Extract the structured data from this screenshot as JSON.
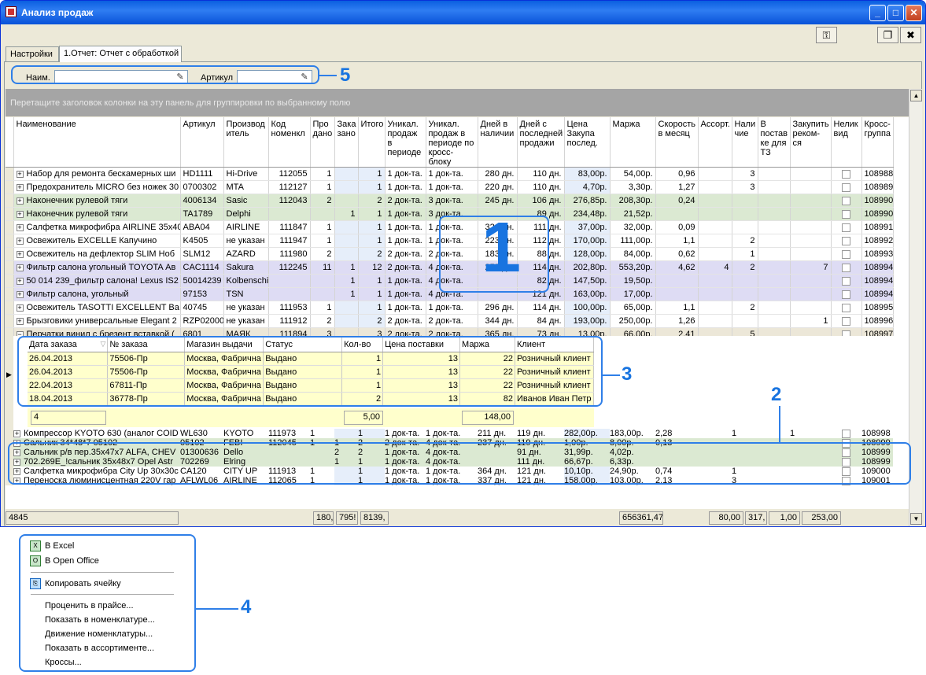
{
  "window": {
    "title": "Анализ продаж"
  },
  "tabs": [
    {
      "label": "Настройки"
    },
    {
      "label": "1.Отчет: Отчет с обработкой"
    }
  ],
  "filters": {
    "name_label": "Наим.",
    "article_label": "Артикул"
  },
  "group_panel_text": "Перетащите заголовок колонки на эту панель для группировки по выбранному полю",
  "columns": [
    "Наименование",
    "Артикул",
    "Производ итель",
    "Код номенкл",
    "Про дано",
    "Зака зано",
    "Итого",
    "Уникал. продаж в периоде",
    "Уникал. продаж в периоде по кросс-блоку",
    "Дней в наличии",
    "Дней с последней продажи",
    "Цена Закупа послед.",
    "Маржа",
    "Скорость в месяц",
    "Ассорт.",
    "Нали чие",
    "В постав ке для ТЗ",
    "Закупить реком-ся",
    "Нелик вид",
    "Кросс- группа"
  ],
  "rows": [
    {
      "style": "white",
      "exp": "+",
      "c": [
        "Набор для ремонта бескамерных ши",
        "HD1111",
        "Hi-Drive",
        "112055",
        "1",
        "",
        "1",
        "1 док-та.",
        "1 док-та.",
        "280 дн.",
        "110 дн.",
        "83,00р.",
        "54,00р.",
        "0,96",
        "",
        "3",
        "",
        "",
        "",
        "108988"
      ]
    },
    {
      "style": "white",
      "exp": "+",
      "c": [
        "Предохранитель MICRO без ножек 30",
        "0700302",
        "MTA",
        "112127",
        "1",
        "",
        "1",
        "1 док-та.",
        "1 док-та.",
        "220 дн.",
        "110 дн.",
        "4,70р.",
        "3,30р.",
        "1,27",
        "",
        "3",
        "",
        "",
        "",
        "108989"
      ]
    },
    {
      "style": "green",
      "exp": "+",
      "c": [
        "Наконечник рулевой тяги",
        "4006134",
        "Sasic",
        "112043",
        "2",
        "",
        "2",
        "2 док-та.",
        "3 док-та.",
        "245 дн.",
        "106 дн.",
        "276,85р.",
        "208,30р.",
        "0,24",
        "",
        "",
        "",
        "",
        "",
        "108990"
      ]
    },
    {
      "style": "green",
      "exp": "+",
      "c": [
        "Наконечник рулевой тяги",
        "TA1789",
        "Delphi",
        "",
        "",
        "1",
        "1",
        "1 док-та.",
        "3 док-та.",
        "",
        "89 дн.",
        "234,48р.",
        "21,52р.",
        "",
        "",
        "",
        "",
        "",
        "",
        "108990"
      ]
    },
    {
      "style": "white",
      "exp": "+",
      "c": [
        "Салфетка микрофибра AIRLINE 35x40",
        "ABA04",
        "AIRLINE",
        "111847",
        "1",
        "",
        "1",
        "1 док-та.",
        "1 док-та.",
        "321 дн.",
        "111 дн.",
        "37,00р.",
        "32,00р.",
        "0,09",
        "",
        "",
        "",
        "",
        "",
        "108991"
      ]
    },
    {
      "style": "white",
      "exp": "+",
      "c": [
        "Освежитель EXCELLE Капучино",
        "K4505",
        "не указан",
        "111947",
        "1",
        "",
        "1",
        "1 док-та.",
        "1 док-та.",
        "223 дн.",
        "112 дн.",
        "170,00р.",
        "111,00р.",
        "1,1",
        "",
        "2",
        "",
        "",
        "",
        "108992"
      ]
    },
    {
      "style": "white",
      "exp": "+",
      "c": [
        "Освежитель на дефлектор SLIM Ноб",
        "SLM12",
        "AZARD",
        "111980",
        "2",
        "",
        "2",
        "2 док-та.",
        "2 док-та.",
        "183 дн.",
        "88 дн.",
        "128,00р.",
        "84,00р.",
        "0,62",
        "",
        "1",
        "",
        "",
        "",
        "108993"
      ]
    },
    {
      "style": "purple",
      "exp": "+",
      "c": [
        "Фильтр салона угольный TOYOTA Ав",
        "CAC1114",
        "Sakura",
        "112245",
        "11",
        "1",
        "12",
        "2 док-та.",
        "4 док-та.",
        "253 дн.",
        "114 дн.",
        "202,80р.",
        "553,20р.",
        "4,62",
        "4",
        "2",
        "",
        "7",
        "",
        "108994"
      ]
    },
    {
      "style": "purple",
      "exp": "+",
      "c": [
        "50 014 239_фильтр салона! Lexus IS2",
        "50014239",
        "Kolbenschi",
        "",
        "",
        "1",
        "1",
        "1 док-та.",
        "4 док-та.",
        "",
        "82 дн.",
        "147,50р.",
        "19,50р.",
        "",
        "",
        "",
        "",
        "",
        "",
        "108994"
      ]
    },
    {
      "style": "purple",
      "exp": "+",
      "c": [
        "Фильтр салона, угольный",
        "97153",
        "TSN",
        "",
        "",
        "1",
        "1",
        "1 док-та.",
        "4 док-та.",
        "",
        "121 дн.",
        "163,00р.",
        "17,00р.",
        "",
        "",
        "",
        "",
        "",
        "",
        "108994"
      ]
    },
    {
      "style": "white",
      "exp": "+",
      "c": [
        "Освежитель TASOTTI EXCELLENT Ва",
        "40745",
        "не указан",
        "111953",
        "1",
        "",
        "1",
        "1 док-та.",
        "1 док-та.",
        "296 дн.",
        "114 дн.",
        "100,00р.",
        "65,00р.",
        "1,1",
        "",
        "2",
        "",
        "",
        "",
        "108995"
      ]
    },
    {
      "style": "white",
      "exp": "+",
      "c": [
        "Брызговики универсальные Elegant 2",
        "RZP02000",
        "не указан",
        "111912",
        "2",
        "",
        "2",
        "2 док-та.",
        "2 док-та.",
        "344 дн.",
        "84 дн.",
        "193,00р.",
        "250,00р.",
        "1,26",
        "",
        "",
        "",
        "1",
        "",
        "108996"
      ]
    },
    {
      "style": "beige",
      "exp": "−",
      "c": [
        "Перчатки винил с брезент вставкой (",
        "6801",
        "МАЯК",
        "111894",
        "3",
        "",
        "3",
        "2 док-та.",
        "2 док-та.",
        "365 дн.",
        "73 дн.",
        "13,00р.",
        "66,00р.",
        "2,41",
        "",
        "5",
        "",
        "",
        "",
        "108997"
      ]
    }
  ],
  "rows_after": [
    {
      "style": "white",
      "exp": "+",
      "c": [
        "Компрессор KYOTO 630 (аналог COID",
        "WL630",
        "KYOTO",
        "111973",
        "1",
        "",
        "1",
        "1 док-та.",
        "1 док-та.",
        "211 дн.",
        "119 дн.",
        "282,00р.",
        "183,00р.",
        "2,28",
        "",
        "1",
        "",
        "1",
        "",
        "108998"
      ]
    },
    {
      "style": "green",
      "exp": "+",
      "c": [
        "Сальник 34*48*7   05102",
        "05102",
        "FEBI",
        "112045",
        "1",
        "1",
        "2",
        "2 док-та.",
        "4 док-та.",
        "237 дн.",
        "119 дн.",
        "1,00р.",
        "8,00р.",
        "0,13",
        "",
        "",
        "",
        "",
        "",
        "108999"
      ]
    },
    {
      "style": "green",
      "exp": "+",
      "c": [
        "Сальник р/в пер.35x47x7 ALFA, CHEV",
        "01300636",
        "Dello",
        "",
        "",
        "2",
        "2",
        "1 док-та.",
        "4 док-та.",
        "",
        "91 дн.",
        "31,99р.",
        "4,02р.",
        "",
        "",
        "",
        "",
        "",
        "",
        "108999"
      ]
    },
    {
      "style": "green",
      "exp": "+",
      "c": [
        "702.269E_!сальник 35x48x7 Opel Astr",
        "702269",
        "Elring",
        "",
        "",
        "1",
        "1",
        "1 док-та.",
        "4 док-та.",
        "",
        "111 дн.",
        "66,67р.",
        "6,33р.",
        "",
        "",
        "",
        "",
        "",
        "",
        "108999"
      ]
    },
    {
      "style": "white",
      "exp": "+",
      "c": [
        "Салфетка микрофибра City Up 30x30c",
        "CA120",
        "CITY UP",
        "111913",
        "1",
        "",
        "1",
        "1 док-та.",
        "1 док-та.",
        "364 дн.",
        "121 дн.",
        "10,10р.",
        "24,90р.",
        "0,74",
        "",
        "1",
        "",
        "",
        "",
        "109000"
      ]
    },
    {
      "style": "white",
      "exp": "+",
      "c": [
        "Переноска люминисцентная 220V гар",
        "AFLWL06",
        "AIRLINE",
        "112065",
        "1",
        "",
        "1",
        "1 док-та.",
        "1 док-та.",
        "337 дн.",
        "121 дн.",
        "158,00р.",
        "103,00р.",
        "2,13",
        "",
        "3",
        "",
        "",
        "",
        "109001"
      ]
    }
  ],
  "detail": {
    "columns": [
      "Дата заказа",
      "№ заказа",
      "Магазин выдачи",
      "Статус",
      "Кол-во",
      "Цена поставки",
      "Маржа",
      "Клиент"
    ],
    "rows": [
      [
        "26.04.2013",
        "75506-Пр",
        "Москва, Фабрична",
        "Выдано",
        "1",
        "13",
        "22",
        "Розничный клиент"
      ],
      [
        "26.04.2013",
        "75506-Пр",
        "Москва, Фабрична",
        "Выдано",
        "1",
        "13",
        "22",
        "Розничный клиент"
      ],
      [
        "22.04.2013",
        "67811-Пр",
        "Москва, Фабрична",
        "Выдано",
        "1",
        "13",
        "22",
        "Розничный клиент"
      ],
      [
        "18.04.2013",
        "36778-Пр",
        "Москва, Фабрична",
        "Выдано",
        "2",
        "13",
        "82",
        "Иванов Иван Петр"
      ]
    ],
    "sum_count": "4",
    "sum_price": "5,00",
    "sum_margin": "148,00"
  },
  "footer": {
    "count": "4845",
    "sold": "180,",
    "ordered": "795!",
    "total": "8139,",
    "margin": "656361,47",
    "assort": "80,00",
    "avail": "317,",
    "tz": "1,00",
    "buy": "253,00"
  },
  "menu": {
    "items": [
      "В Excel",
      "В Open Office",
      "Копировать ячейку",
      "Проценить в прайсе...",
      "Показать в номенклатуре...",
      "Движение номенклатуры...",
      "Показать в ассортименте...",
      "Кроссы..."
    ]
  },
  "callouts": [
    "1",
    "2",
    "3",
    "4",
    "5"
  ],
  "colors": {
    "accent": "#2f7fe8",
    "green_row": "#dbe9d2",
    "purple_row": "#dedcf4",
    "detail_bg": "#ffffcc"
  }
}
